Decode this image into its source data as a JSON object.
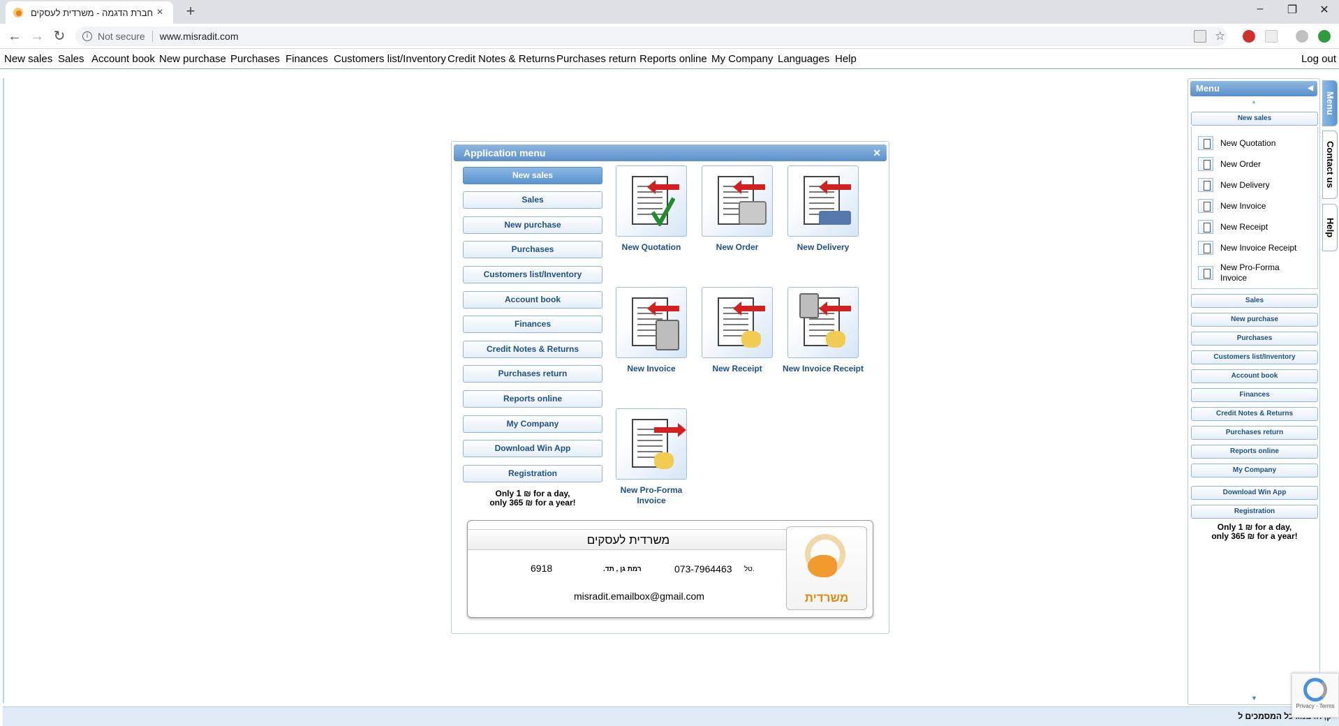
{
  "browser": {
    "tab_title": "חברת הדגמה - משרדית לעסקים",
    "address_security": "Not secure",
    "address_url": "www.misradit.com"
  },
  "topnav": {
    "items": [
      "New sales",
      "Sales",
      "Account book",
      "New purchase",
      "Purchases",
      "Finances",
      "Customers list/Inventory",
      "Credit Notes & Returns",
      "Purchases return",
      "Reports online",
      "My Company",
      "Languages",
      "Help"
    ],
    "logout": "Log out"
  },
  "app_menu": {
    "title": "Application menu",
    "buttons": [
      "New sales",
      "Sales",
      "New purchase",
      "Purchases",
      "Customers list/Inventory",
      "Account book",
      "Finances",
      "Credit Notes & Returns",
      "Purchases return",
      "Reports online",
      "My Company",
      "Download Win App",
      "Registration"
    ],
    "active_button": "New sales",
    "promo_line1_a": "Only ",
    "promo_line1_b": "1",
    "promo_line1_c": " ₪ for a day,",
    "promo_line2": "only 365 ₪ for a year!",
    "tiles": [
      {
        "label": "New Quotation",
        "icon": "quotation-icon"
      },
      {
        "label": "New Order",
        "icon": "order-icon"
      },
      {
        "label": "New Delivery",
        "icon": "delivery-icon"
      },
      {
        "label": "New Invoice",
        "icon": "invoice-icon"
      },
      {
        "label": "New Receipt",
        "icon": "receipt-icon"
      },
      {
        "label": "New Invoice Receipt",
        "icon": "invoice-receipt-icon"
      },
      {
        "label": "New Pro-Forma Invoice",
        "icon": "pro-forma-icon"
      }
    ],
    "card": {
      "company": "משרדית לעסקים",
      "city": "רמת גן , תד.",
      "po_box": "6918",
      "phone_label": "טל.",
      "phone": "073-7964463",
      "email": "misradit.emailbox@gmail.com",
      "logo_text": "משרדית"
    }
  },
  "side_menu": {
    "title": "Menu",
    "section_new_sales": "New sales",
    "sub_items": [
      "New Quotation",
      "New Order",
      "New Delivery",
      "New Invoice",
      "New Receipt",
      "New Invoice Receipt",
      "New Pro-Forma Invoice"
    ],
    "buttons": [
      "Sales",
      "New purchase",
      "Purchases",
      "Customers list/Inventory",
      "Account book",
      "Finances",
      "Credit Notes & Returns",
      "Purchases return",
      "Reports online",
      "My Company",
      "Download Win App",
      "Registration"
    ],
    "promo_line1": "Only 1 ₪ for a day,",
    "promo_line2": "only 365 ₪ for a year!"
  },
  "side_tabs": [
    "Menu",
    "Contact us",
    "Help"
  ],
  "footer_text": "ק, חו בנוג כל המסמכים ל",
  "recaptcha_text": "Privacy - Terms",
  "colors": {
    "accent": "#5b8fc8",
    "button_text": "#1e4f86",
    "logo": "#e08a10"
  }
}
